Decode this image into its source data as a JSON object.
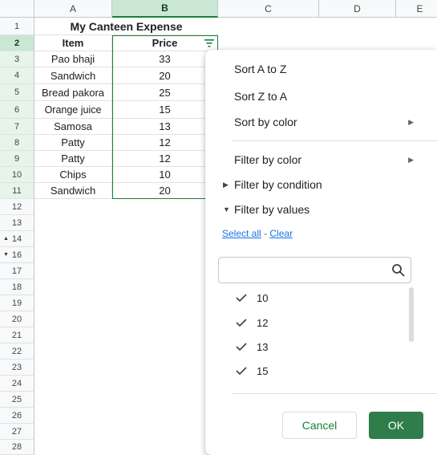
{
  "columns": [
    "A",
    "B",
    "C",
    "D",
    "E"
  ],
  "rows": [
    "1",
    "2",
    "3",
    "4",
    "5",
    "6",
    "7",
    "8",
    "9",
    "10",
    "11",
    "12",
    "13",
    "14",
    "16",
    "17",
    "18",
    "19",
    "20",
    "21",
    "22",
    "23",
    "24",
    "25",
    "26",
    "27",
    "28"
  ],
  "sheet": {
    "title": "My Canteen Expense",
    "headers": {
      "item": "Item",
      "price": "Price"
    },
    "data": [
      {
        "item": "Pao bhaji",
        "price": "33"
      },
      {
        "item": "Sandwich",
        "price": "20"
      },
      {
        "item": "Bread pakora",
        "price": "25"
      },
      {
        "item": "Orange juice",
        "price": "15"
      },
      {
        "item": "Samosa",
        "price": "13"
      },
      {
        "item": "Patty",
        "price": "12"
      },
      {
        "item": "Patty",
        "price": "12"
      },
      {
        "item": "Chips",
        "price": "10"
      },
      {
        "item": "Sandwich",
        "price": "20"
      }
    ]
  },
  "filter_menu": {
    "sort_az": "Sort A to Z",
    "sort_za": "Sort Z to A",
    "sort_color": "Sort by color",
    "filter_color": "Filter by color",
    "filter_condition": "Filter by condition",
    "filter_values": "Filter by values",
    "select_all": "Select all",
    "separator": "-",
    "clear": "Clear",
    "search_placeholder": "",
    "values": [
      "10",
      "12",
      "13",
      "15"
    ],
    "cancel": "Cancel",
    "ok": "OK"
  },
  "colors": {
    "accent": "#188038",
    "ok_button": "#2e7d4a",
    "link": "#1a73e8",
    "selected_header": "#c9e7d3"
  },
  "icons": [
    "filter-icon",
    "search-icon",
    "checkmark-icon",
    "submenu-arrow-icon",
    "collapse-triangle-icon",
    "expand-triangle-icon"
  ]
}
